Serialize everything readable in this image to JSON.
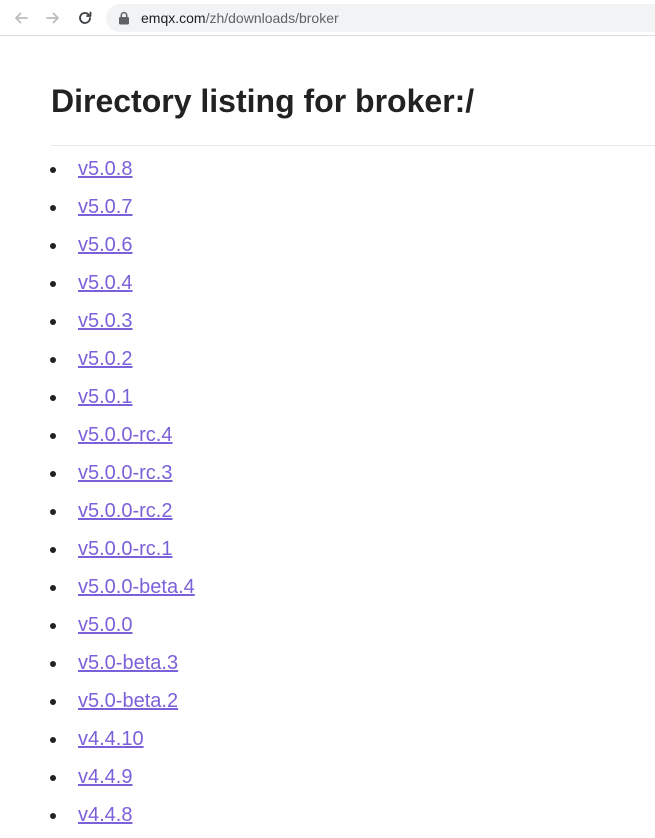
{
  "browser": {
    "url_host": "emqx.com",
    "url_path": "/zh/downloads/broker"
  },
  "page": {
    "title": "Directory listing for broker:/",
    "links": [
      {
        "label": "v5.0.8"
      },
      {
        "label": "v5.0.7"
      },
      {
        "label": "v5.0.6"
      },
      {
        "label": "v5.0.4"
      },
      {
        "label": "v5.0.3"
      },
      {
        "label": "v5.0.2"
      },
      {
        "label": "v5.0.1"
      },
      {
        "label": "v5.0.0-rc.4"
      },
      {
        "label": "v5.0.0-rc.3"
      },
      {
        "label": "v5.0.0-rc.2"
      },
      {
        "label": "v5.0.0-rc.1"
      },
      {
        "label": "v5.0.0-beta.4"
      },
      {
        "label": "v5.0.0"
      },
      {
        "label": "v5.0-beta.3"
      },
      {
        "label": "v5.0-beta.2"
      },
      {
        "label": "v4.4.10"
      },
      {
        "label": "v4.4.9"
      },
      {
        "label": "v4.4.8"
      }
    ]
  },
  "colors": {
    "link": "#7b61d9",
    "heading": "#222222",
    "omnibox": "#f1f3f4"
  },
  "icons": {
    "back": "arrow-left-icon",
    "forward": "arrow-right-icon",
    "reload": "reload-icon",
    "lock": "lock-icon"
  }
}
